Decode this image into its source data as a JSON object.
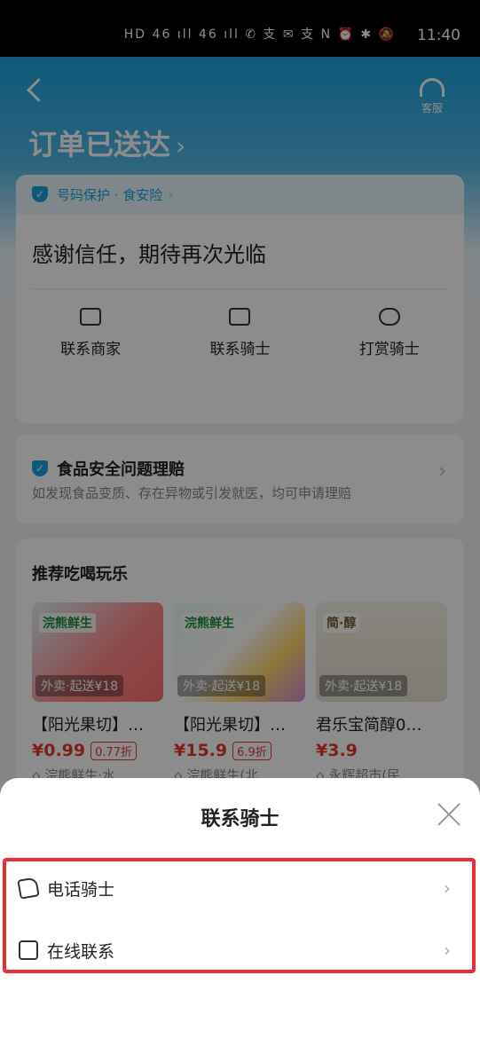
{
  "status_bar": {
    "time": "11:40",
    "battery": "63",
    "icons_text": "HD 46 ıll 46 ıll ✆ 支 ✉ 支   N ⏰ ✱ 🔕"
  },
  "header": {
    "title": "订单已送达",
    "chevron": "›",
    "customer_service": "客服"
  },
  "protection_bar": {
    "label": "号码保护 · 食安险",
    "chevron": "›"
  },
  "thanks_text": "感谢信任，期待再次光临",
  "actions": [
    {
      "label": "联系商家",
      "icon": "chat-icon"
    },
    {
      "label": "联系骑士",
      "icon": "chat-icon"
    },
    {
      "label": "打赏骑士",
      "icon": "money-bag-icon"
    }
  ],
  "food_safety": {
    "title": "食品安全问题理赔",
    "subtitle": "如发现食品变质、存在异物或引发就医，均可申请理赔",
    "chevron": "›"
  },
  "recommend": {
    "title": "推荐吃喝玩乐",
    "products": [
      {
        "brand": "浣熊鲜生",
        "tag": "外卖·起送¥18",
        "name": "【阳光果切】…",
        "price": "¥0.99",
        "discount": "0.77折",
        "shop": "⌂ 浣熊鲜生·水…"
      },
      {
        "brand": "浣熊鲜生",
        "tag": "外卖·起送¥18",
        "name": "【阳光果切】…",
        "price": "¥15.9",
        "discount": "6.9折",
        "shop": "⌂ 浣熊鲜生(北…"
      },
      {
        "brand": "简·醇",
        "tag": "外卖·起送¥18",
        "name": "君乐宝简醇0…",
        "price": "¥3.9",
        "discount": "",
        "shop": "⌂ 永辉超市(民…"
      }
    ]
  },
  "sheet": {
    "title": "联系骑士",
    "options": [
      {
        "label": "电话骑士",
        "icon": "phone-icon",
        "chevron": "›"
      },
      {
        "label": "在线联系",
        "icon": "chat-icon",
        "chevron": "›"
      }
    ]
  },
  "colors": {
    "accent": "#1aa3df",
    "price": "#e8352c",
    "highlight": "#ef2b36"
  }
}
